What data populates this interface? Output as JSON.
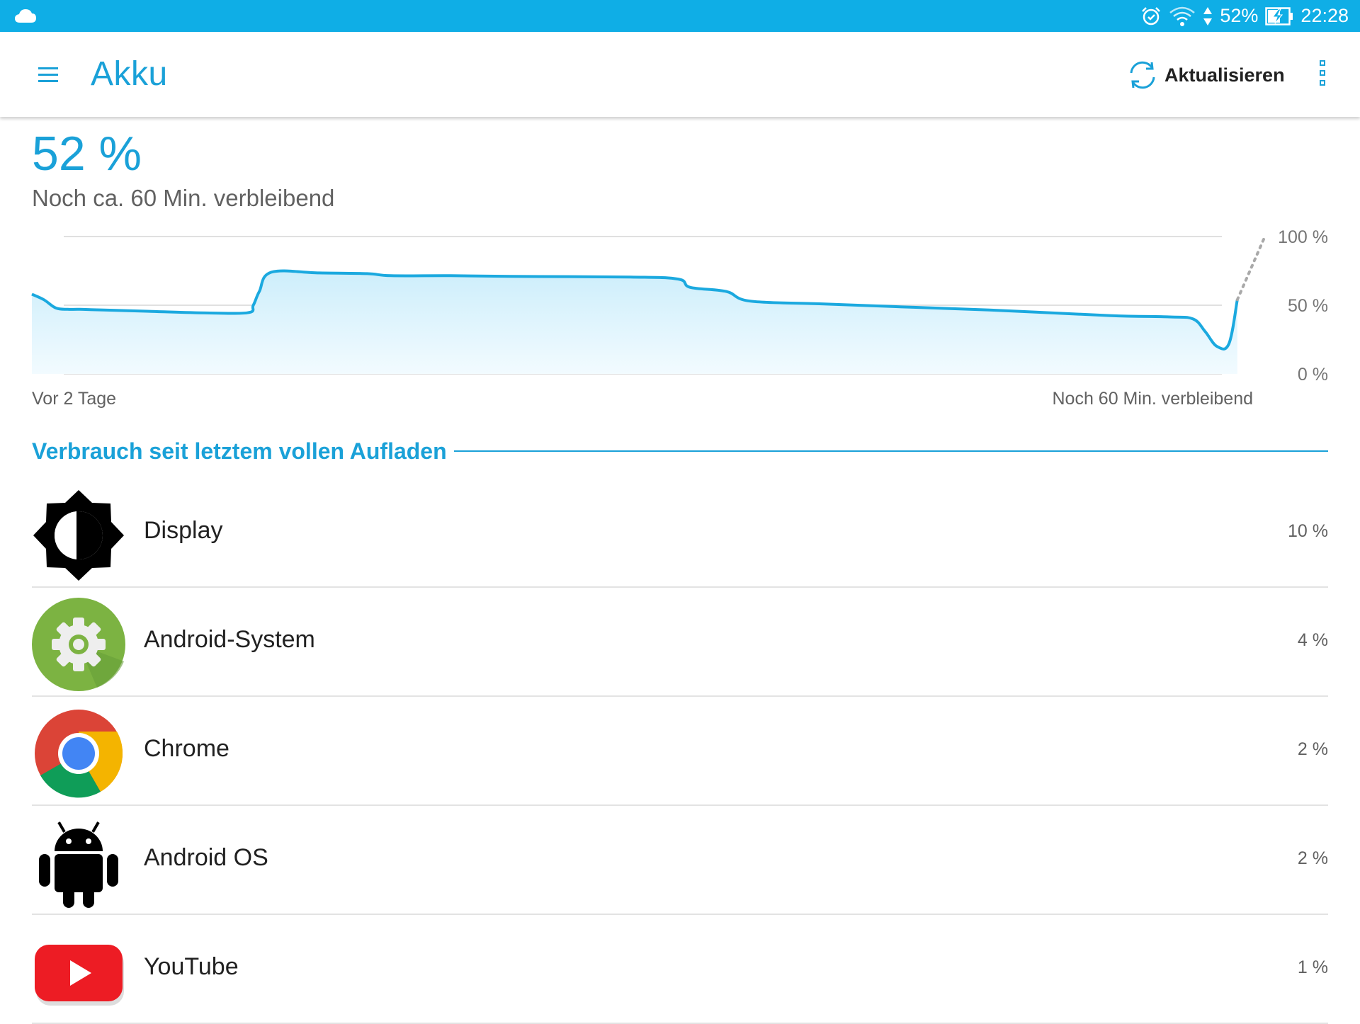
{
  "status_bar": {
    "battery_text": "52%",
    "time": "22:28",
    "icons": [
      "cloud-icon",
      "alarm-icon",
      "wifi-icon",
      "data-arrows-icon",
      "battery-charging-icon"
    ]
  },
  "app_bar": {
    "title": "Akku",
    "refresh_label": "Aktualisieren",
    "icons": [
      "menu-icon",
      "refresh-icon",
      "overflow-menu-icon"
    ]
  },
  "summary": {
    "percent": "52 %",
    "remaining": "Noch ca. 60 Min. verbleibend"
  },
  "chart_data": {
    "type": "area",
    "x_start_label": "Vor 2 Tage",
    "x_end_label": "Noch 60 Min. verbleibend",
    "y_tick_labels": [
      "100 %",
      "50 %",
      "0 %"
    ],
    "ylim": [
      0,
      100
    ],
    "grid": true,
    "line_color": "#1ba9df",
    "x": [
      0,
      1,
      2,
      3,
      4,
      6,
      10,
      14,
      18,
      18.5,
      19,
      20,
      24,
      28,
      30,
      35,
      40,
      50,
      54,
      55,
      58,
      60,
      66,
      72,
      80,
      90,
      95,
      97,
      98,
      99,
      100,
      100.7
    ],
    "y": [
      58,
      54,
      48,
      47,
      47,
      46.5,
      45.5,
      44.5,
      44.5,
      50,
      60,
      74,
      73.5,
      73,
      71.5,
      71.5,
      71,
      70.5,
      69,
      63,
      60,
      53,
      51,
      49,
      46.5,
      42.5,
      41.5,
      40,
      31,
      20,
      22,
      54
    ],
    "projection": {
      "x": [
        100.7,
        103
      ],
      "y": [
        54,
        100
      ]
    }
  },
  "section": {
    "title": "Verbrauch seit letztem vollen Aufladen"
  },
  "apps": [
    {
      "name": "Display",
      "percent": "10 %",
      "icon": "display-brightness-icon"
    },
    {
      "name": "Android-System",
      "percent": "4 %",
      "icon": "android-system-gear-icon"
    },
    {
      "name": "Chrome",
      "percent": "2 %",
      "icon": "chrome-icon"
    },
    {
      "name": "Android OS",
      "percent": "2 %",
      "icon": "android-robot-icon"
    },
    {
      "name": "YouTube",
      "percent": "1 %",
      "icon": "youtube-icon"
    }
  ],
  "colors": {
    "accent": "#1aa1d8",
    "status_bar": "#0faee6",
    "fill_top": "#cdeefb",
    "fill_bottom": "#f2fbff"
  }
}
